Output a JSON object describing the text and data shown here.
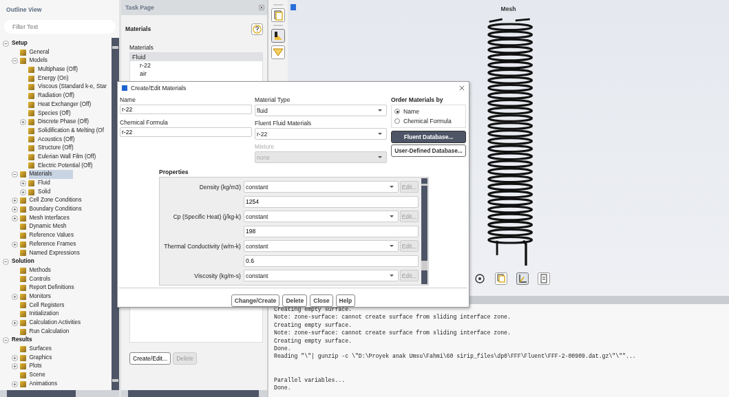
{
  "outline": {
    "title": "Outline View",
    "filter": {
      "placeholder": "Filter Text"
    },
    "tree": [
      {
        "label": "Setup",
        "selected": false,
        "expanded": true,
        "children": [
          {
            "label": "General",
            "selected": false
          },
          {
            "label": "Models",
            "selected": false,
            "expanded": true,
            "children": [
              {
                "label": "Multiphase (Off)",
                "selected": false
              },
              {
                "label": "Energy (On)",
                "selected": false
              },
              {
                "label": "Viscous (Standard k-e, Star",
                "selected": false
              },
              {
                "label": "Radiation (Off)",
                "selected": false
              },
              {
                "label": "Heat Exchanger (Off)",
                "selected": false
              },
              {
                "label": "Species (Off)",
                "selected": false
              },
              {
                "label": "Discrete Phase (Off)",
                "selected": false,
                "expanded": false
              },
              {
                "label": "Solidification & Melting (Of",
                "selected": false
              },
              {
                "label": "Acoustics (Off)",
                "selected": false
              },
              {
                "label": "Structure (Off)",
                "selected": false
              },
              {
                "label": "Eulerian Wall Film (Off)",
                "selected": false
              },
              {
                "label": "Electric Potential (Off)",
                "selected": false
              }
            ]
          },
          {
            "label": "Materials",
            "selected": true,
            "expanded": true,
            "children": [
              {
                "label": "Fluid",
                "selected": false,
                "expanded": false
              },
              {
                "label": "Solid",
                "selected": false,
                "expanded": false
              }
            ]
          },
          {
            "label": "Cell Zone Conditions",
            "selected": false,
            "expanded": false
          },
          {
            "label": "Boundary Conditions",
            "selected": false,
            "expanded": false
          },
          {
            "label": "Mesh Interfaces",
            "selected": false,
            "expanded": false
          },
          {
            "label": "Dynamic Mesh",
            "selected": false
          },
          {
            "label": "Reference Values",
            "selected": false
          },
          {
            "label": "Reference Frames",
            "selected": false,
            "expanded": false
          },
          {
            "label": "Named Expressions",
            "selected": false
          }
        ]
      },
      {
        "label": "Solution",
        "selected": false,
        "expanded": true,
        "children": [
          {
            "label": "Methods",
            "selected": false
          },
          {
            "label": "Controls",
            "selected": false
          },
          {
            "label": "Report Definitions",
            "selected": false
          },
          {
            "label": "Monitors",
            "selected": false,
            "expanded": false
          },
          {
            "label": "Cell Registers",
            "selected": false
          },
          {
            "label": "Initialization",
            "selected": false
          },
          {
            "label": "Calculation Activities",
            "selected": false,
            "expanded": false
          },
          {
            "label": "Run Calculation",
            "selected": false
          }
        ]
      },
      {
        "label": "Results",
        "selected": false,
        "expanded": true,
        "children": [
          {
            "label": "Surfaces",
            "selected": false
          },
          {
            "label": "Graphics",
            "selected": false,
            "expanded": false
          },
          {
            "label": "Plots",
            "selected": false,
            "expanded": false
          },
          {
            "label": "Scene",
            "selected": false
          },
          {
            "label": "Animations",
            "selected": false,
            "expanded": false
          }
        ]
      }
    ]
  },
  "task_page": {
    "title": "Task Page",
    "heading": "Materials",
    "list_label": "Materials",
    "materials": [
      {
        "label": "Fluid",
        "kind": "group"
      },
      {
        "label": "r-22",
        "kind": "item"
      },
      {
        "label": "air",
        "kind": "item"
      }
    ],
    "buttons": [
      {
        "label": "Create/Edit...",
        "disabled": false
      },
      {
        "label": "Delete",
        "disabled": true
      }
    ]
  },
  "graphics": {
    "title": "Mesh"
  },
  "dialog": {
    "title": "Create/Edit Materials",
    "name": {
      "label": "Name",
      "value": "r-22"
    },
    "chemical_formula": {
      "label": "Chemical Formula",
      "value": "r-22"
    },
    "material_type": {
      "label": "Material Type",
      "value": "fluid",
      "disabled": false
    },
    "fluent_materials": {
      "label": "Fluent Fluid Materials",
      "value": "r-22",
      "disabled": false
    },
    "mixture": {
      "label": "Mixture",
      "value": "none",
      "disabled": true
    },
    "order_by": {
      "label": "Order Materials by",
      "options": [
        {
          "label": "Name",
          "selected": true
        },
        {
          "label": "Chemical Formula",
          "selected": false
        }
      ]
    },
    "database_buttons": [
      {
        "label": "Fluent Database...",
        "kind": "primary"
      },
      {
        "label": "User-Defined Database...",
        "kind": "secondary"
      }
    ],
    "properties_label": "Properties",
    "properties": [
      {
        "label": "Density (kg/m3)",
        "method": "constant",
        "edit": "Edit...",
        "edit_disabled": true,
        "value": "1254"
      },
      {
        "label": "Cp (Specific Heat) (j/kg-k)",
        "method": "constant",
        "edit": "Edit...",
        "edit_disabled": true,
        "value": "198"
      },
      {
        "label": "Thermal Conductivity (w/m-k)",
        "method": "constant",
        "edit": "Edit...",
        "edit_disabled": true,
        "value": "0.6"
      },
      {
        "label": "Viscosity (kg/m-s)",
        "method": "constant",
        "edit": "Edit...",
        "edit_disabled": true
      }
    ],
    "buttons": [
      "Change/Create",
      "Delete",
      "Close",
      "Help"
    ]
  },
  "console": {
    "blocks": [
      {
        "lines": [
          "Creating empty surface.",
          "Note: zone-surface: cannot create surface from sliding interface zone.",
          "Creating empty surface.",
          "Note: zone-surface: cannot create surface from sliding interface zone.",
          "Creating empty surface.",
          "Done.",
          "Reading \"\\\"| gunzip -c \\\"D:\\Proyek anak Umsu\\Fahmi\\60 sirip_files\\dp0\\FFF\\Fluent\\FFF-2-00909.dat.gz\\\"\\\"\"..."
        ]
      },
      {
        "lines": [
          "Parallel variables...",
          "Done."
        ]
      }
    ]
  }
}
